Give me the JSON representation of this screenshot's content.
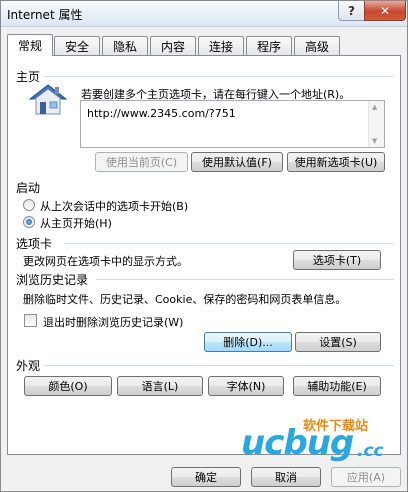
{
  "window": {
    "title": "Internet 属性",
    "help_glyph": "?",
    "close_glyph": "✕"
  },
  "tabs": [
    {
      "label": "常规",
      "active": true
    },
    {
      "label": "安全"
    },
    {
      "label": "隐私"
    },
    {
      "label": "内容"
    },
    {
      "label": "连接"
    },
    {
      "label": "程序"
    },
    {
      "label": "高级"
    }
  ],
  "home": {
    "section_title": "主页",
    "instruction": "若要创建多个主页选项卡，请在每行键入一个地址(R)。",
    "url_value": "http://www.2345.com/?751",
    "icon": "house-icon",
    "buttons": {
      "use_current": "使用当前页(C)",
      "use_default": "使用默认值(F)",
      "use_new_tab": "使用新选项卡(U)"
    }
  },
  "startup": {
    "section_title": "启动",
    "option_last_session": "从上次会话中的选项卡开始(B)",
    "option_home": "从主页开始(H)",
    "selected": "home"
  },
  "tabs_section": {
    "section_title": "选项卡",
    "description": "更改网页在选项卡中的显示方式。",
    "button": "选项卡(T)"
  },
  "history": {
    "section_title": "浏览历史记录",
    "description": "删除临时文件、历史记录、Cookie、保存的密码和网页表单信息。",
    "checkbox_label": "退出时删除浏览历史记录(W)",
    "checkbox_checked": false,
    "delete_button": "删除(D)...",
    "settings_button": "设置(S)"
  },
  "appearance": {
    "section_title": "外观",
    "buttons": {
      "colors": "颜色(O)",
      "languages": "语言(L)",
      "fonts": "字体(N)",
      "accessibility": "辅助功能(E)"
    }
  },
  "footer": {
    "ok": "确定",
    "cancel": "取消",
    "apply": "应用(A)"
  },
  "watermark": {
    "brand_letters": "ucbug",
    "tld": ".cc",
    "cn_text": "软件下载站"
  }
}
